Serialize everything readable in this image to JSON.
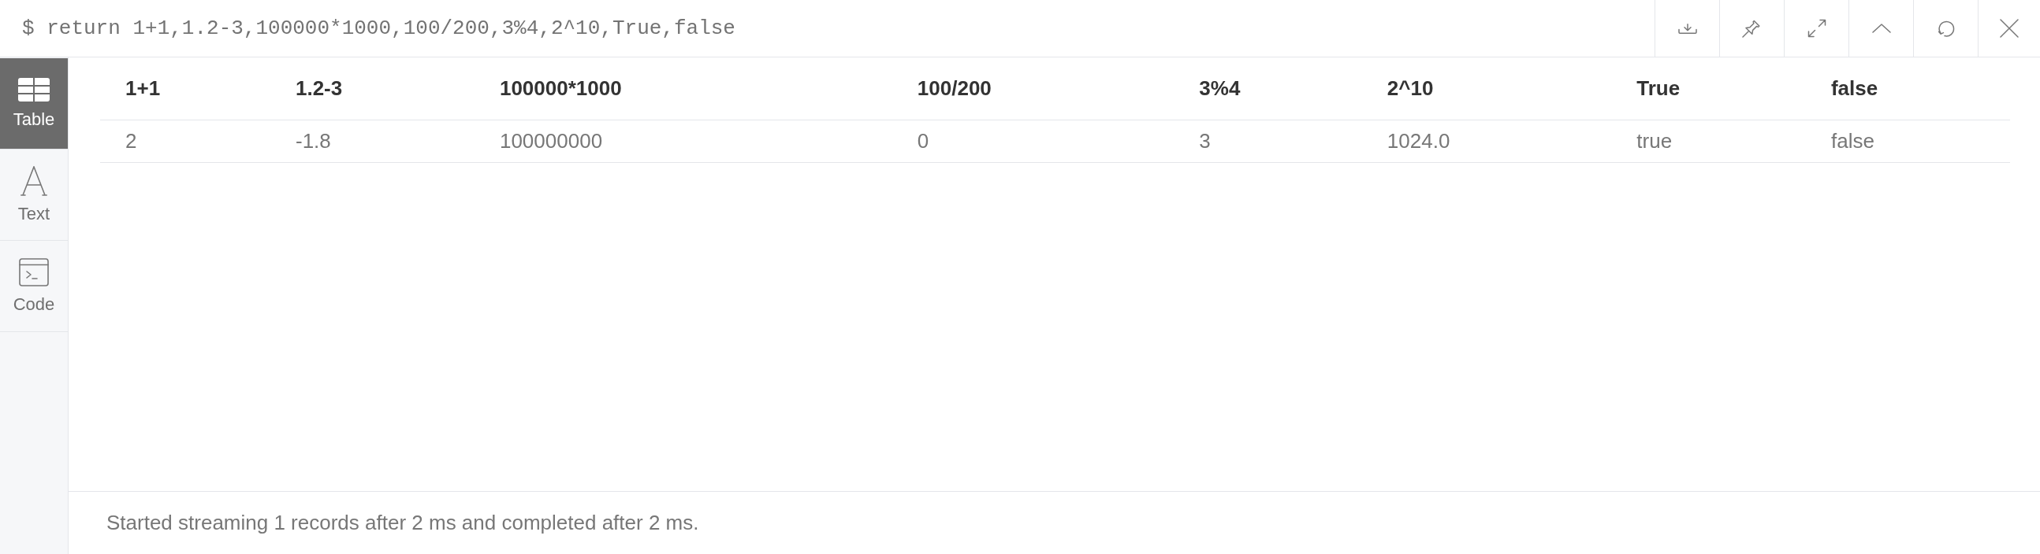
{
  "command": {
    "text": "$ return 1+1,1.2-3,100000*1000,100/200,3%4,2^10,True,false"
  },
  "sidebar": {
    "items": [
      {
        "label": "Table",
        "selected": true
      },
      {
        "label": "Text",
        "selected": false
      },
      {
        "label": "Code",
        "selected": false
      }
    ]
  },
  "table": {
    "columns": [
      "1+1",
      "1.2-3",
      "100000*1000",
      "100/200",
      "3%4",
      "2^10",
      "True",
      "false"
    ],
    "rows": [
      [
        "2",
        "-1.8",
        "100000000",
        "0",
        "3",
        "1024.0",
        "true",
        "false"
      ]
    ]
  },
  "status_bar": {
    "text": "Started streaming 1 records after 2 ms and completed after 2 ms."
  }
}
